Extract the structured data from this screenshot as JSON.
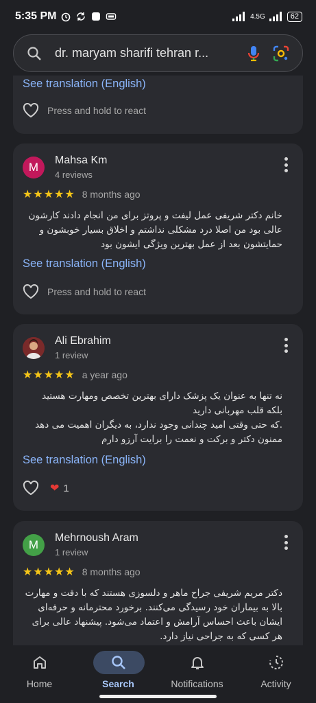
{
  "status": {
    "time": "5:35 PM",
    "network": "4.5G",
    "battery": "62"
  },
  "search": {
    "query": "dr. maryam sharifi tehran r...",
    "icons": [
      "search-icon",
      "mic-icon",
      "lens-icon"
    ]
  },
  "top_card": {
    "translation": "See translation (English)",
    "react_label": "Press and hold to react"
  },
  "reviews": [
    {
      "name": "Mahsa Km",
      "avatar_letter": "M",
      "avatar_color": "#c2185b",
      "review_count": "4 reviews",
      "stars": "★★★★★",
      "date": "8 months ago",
      "text": "خانم دکتر شریفی عمل لیفت و پروتز برای من انجام دادند کارشون عالی بود من اصلا درد مشکلی نداشتم و اخلاق بسیار خوبشون و حمایتشون بعد از عمل بهترین ویژگی ایشون بود",
      "translation": "See translation (English)",
      "react_label": "Press and hold to react"
    },
    {
      "name": "Ali Ebrahim",
      "review_count": "1 review",
      "stars": "★★★★★",
      "date": "a year ago",
      "text_lines": [
        "نه تنها به عنوان یک پزشک دارای بهترین تخصص ومهارت هستید",
        "بلکه قلب مهربانی دارید",
        ".که حتی وقتی امید چندانی وجود ندارد، به دیگران اهمیت می دهد",
        "ممنون دکتر و برکت و نعمت را برایت آرزو دارم"
      ],
      "translation": "See translation (English)",
      "reaction_count": "1"
    },
    {
      "name": "Mehrnoush Aram",
      "avatar_letter": "M",
      "avatar_color": "#43a047",
      "review_count": "1 review",
      "stars": "★★★★★",
      "date": "8 months ago",
      "text": "دکتر مریم شریفی جراح ماهر و دلسوزی هستند که با دقت و مهارت بالا به بیماران خود رسیدگی می‌کنند. برخورد محترمانه و حرفه‌ای ایشان باعث احساس آرامش و اعتماد می‌شود. پیشنهاد عالی برای هر کسی که به جراحی نیاز دارد."
    }
  ],
  "nav": [
    {
      "label": "Home",
      "icon": "home-icon"
    },
    {
      "label": "Search",
      "icon": "search-icon",
      "active": true
    },
    {
      "label": "Notifications",
      "icon": "bell-icon"
    },
    {
      "label": "Activity",
      "icon": "activity-icon"
    }
  ],
  "colors": {
    "background": "#1f2024",
    "card": "#2a2b30",
    "link": "#8ab4f8",
    "star": "#f5c518",
    "active_nav": "#a8c7fa"
  }
}
